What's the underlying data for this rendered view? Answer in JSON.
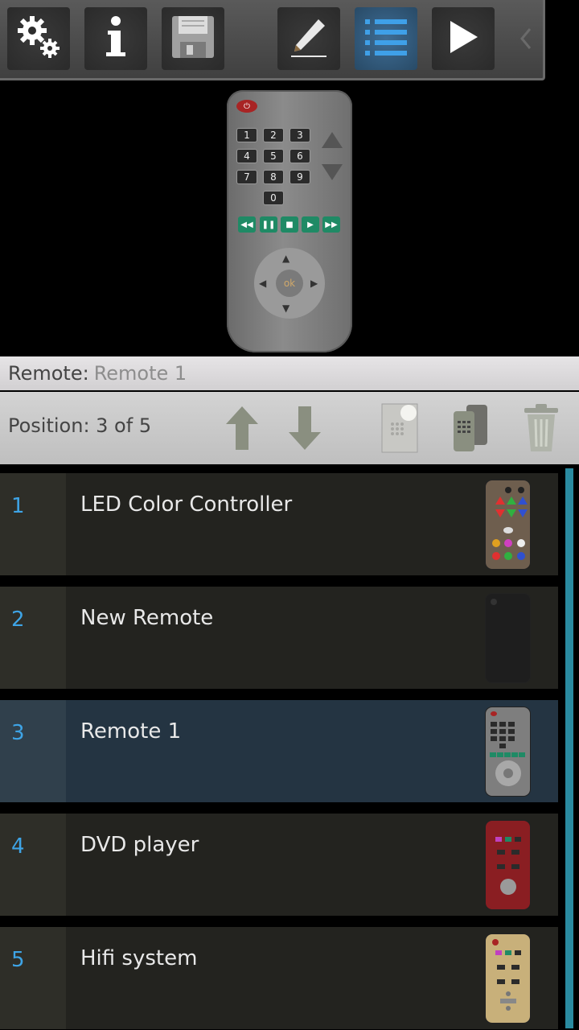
{
  "toolbar": {
    "buttons": [
      "settings",
      "info",
      "save",
      "edit",
      "list",
      "play"
    ],
    "active": "list"
  },
  "preview": {
    "numbers": [
      "1",
      "2",
      "3",
      "4",
      "5",
      "6",
      "7",
      "8",
      "9",
      "0"
    ],
    "ok_label": "ok"
  },
  "remote_info": {
    "label": "Remote:",
    "value": "Remote 1"
  },
  "position_info": {
    "text": "Position: 3 of 5"
  },
  "list": [
    {
      "index": "1",
      "name": "LED Color Controller",
      "thumb": "led",
      "selected": false
    },
    {
      "index": "2",
      "name": "New Remote",
      "thumb": "blank",
      "selected": false
    },
    {
      "index": "3",
      "name": "Remote 1",
      "thumb": "grey",
      "selected": true
    },
    {
      "index": "4",
      "name": "DVD player",
      "thumb": "red",
      "selected": false
    },
    {
      "index": "5",
      "name": "Hifi system",
      "thumb": "gold",
      "selected": false
    }
  ],
  "colors": {
    "accent": "#3ea4e6",
    "selected_row": "#243442",
    "scrollbar": "#2a8aa0"
  }
}
